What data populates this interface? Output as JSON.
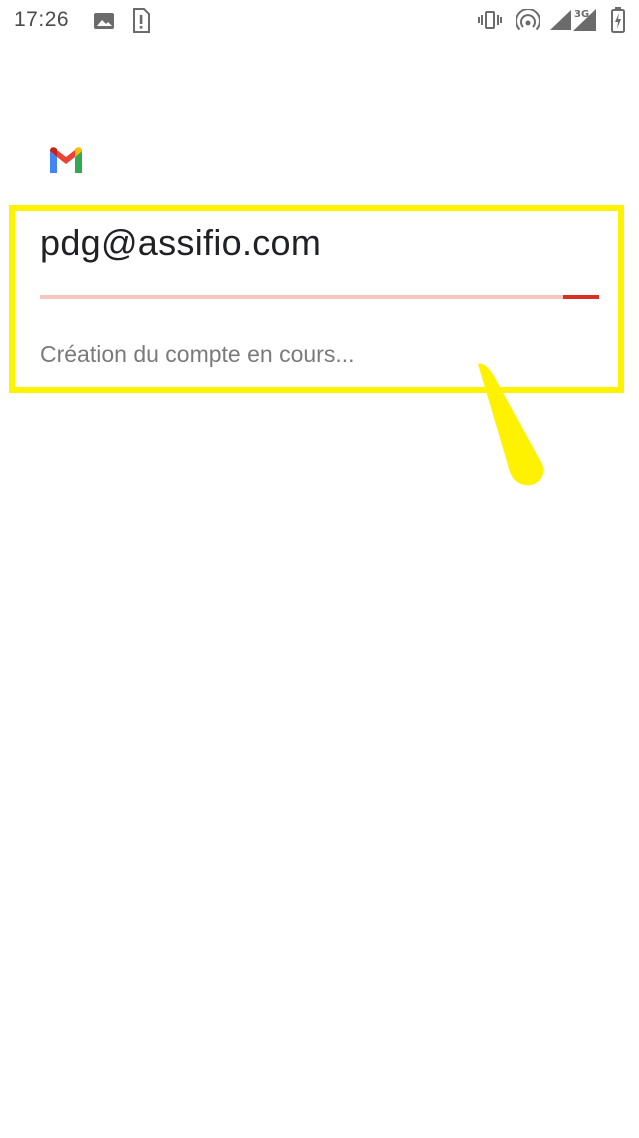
{
  "status_bar": {
    "time": "17:26",
    "icons": [
      "image-notification-icon",
      "sim-alert-icon",
      "vibrate-icon",
      "hotspot-icon",
      "signal-icon",
      "signal-3g-icon",
      "battery-charging-icon"
    ],
    "network_label": "3G"
  },
  "app": {
    "logo": "gmail-logo",
    "brand_colors": {
      "red": "#ea4335",
      "blue": "#4285f4",
      "green": "#34a853",
      "yellow": "#fbbc04"
    }
  },
  "account_setup": {
    "email": "pdg@assifio.com",
    "status_text": "Création du compte en cours...",
    "progress_indicator": {
      "start_fraction": 0.935,
      "end_fraction": 1.0,
      "track_color": "#f4c7c3",
      "indicator_color": "#d93025"
    }
  },
  "annotation": {
    "highlight_color": "#fff200"
  }
}
